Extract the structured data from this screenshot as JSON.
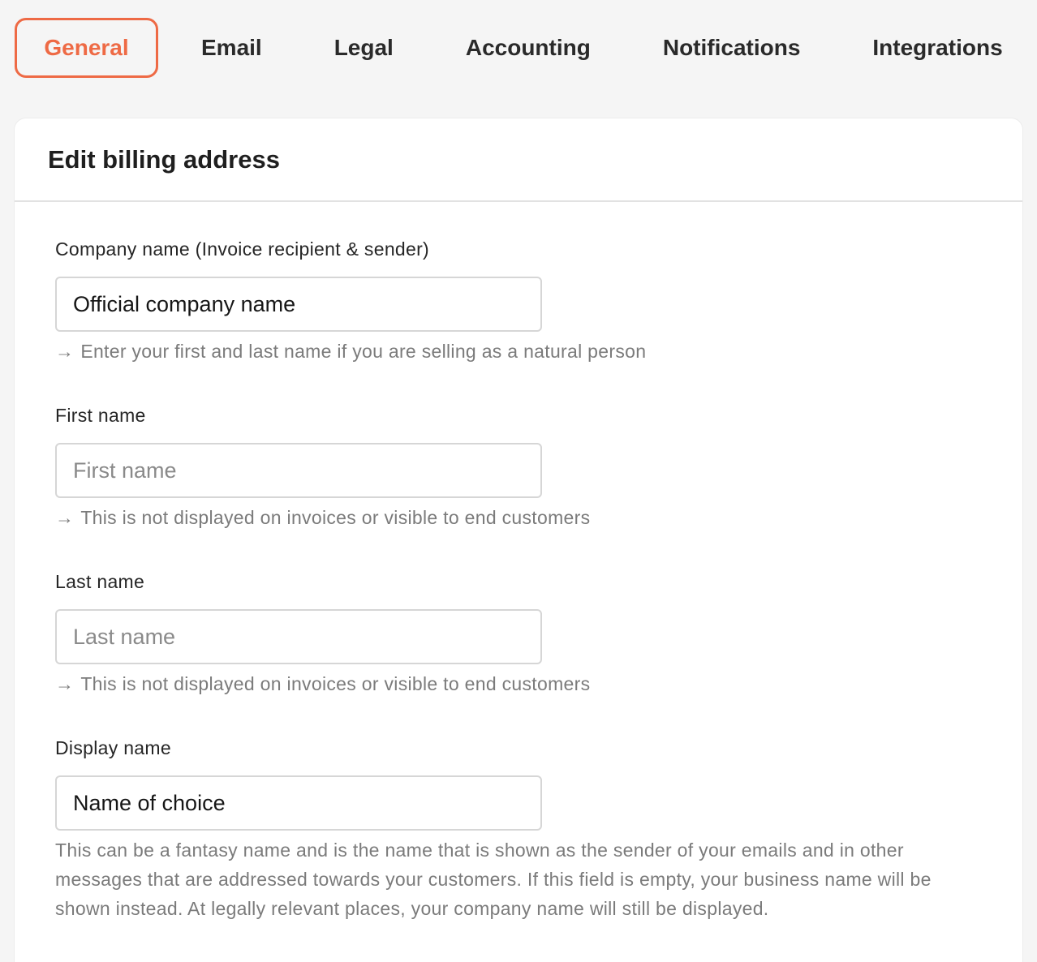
{
  "tabs": [
    {
      "label": "General",
      "active": true
    },
    {
      "label": "Email"
    },
    {
      "label": "Legal"
    },
    {
      "label": "Accounting"
    },
    {
      "label": "Notifications"
    },
    {
      "label": "Integrations"
    }
  ],
  "colors": {
    "accent": "#ee6a45"
  },
  "card": {
    "title": "Edit billing address",
    "fields": {
      "company": {
        "label": "Company name (Invoice recipient & sender)",
        "value": "Official company name",
        "hint": "Enter your first and last name if you are selling as a natural person"
      },
      "first_name": {
        "label": "First name",
        "placeholder": "First name",
        "hint": "This is not displayed on invoices or visible to end customers"
      },
      "last_name": {
        "label": "Last name",
        "placeholder": "Last name",
        "hint": "This is not displayed on invoices or visible to end customers"
      },
      "display_name": {
        "label": "Display name",
        "value": "Name of choice",
        "hint": "This can be a fantasy name and is the name that is shown as the sender of your emails and in other messages that are addressed towards your customers. If this field is empty, your business name will be shown instead. At legally relevant places, your company name will still be displayed."
      }
    }
  },
  "icons": {
    "hint_arrow": "→"
  }
}
